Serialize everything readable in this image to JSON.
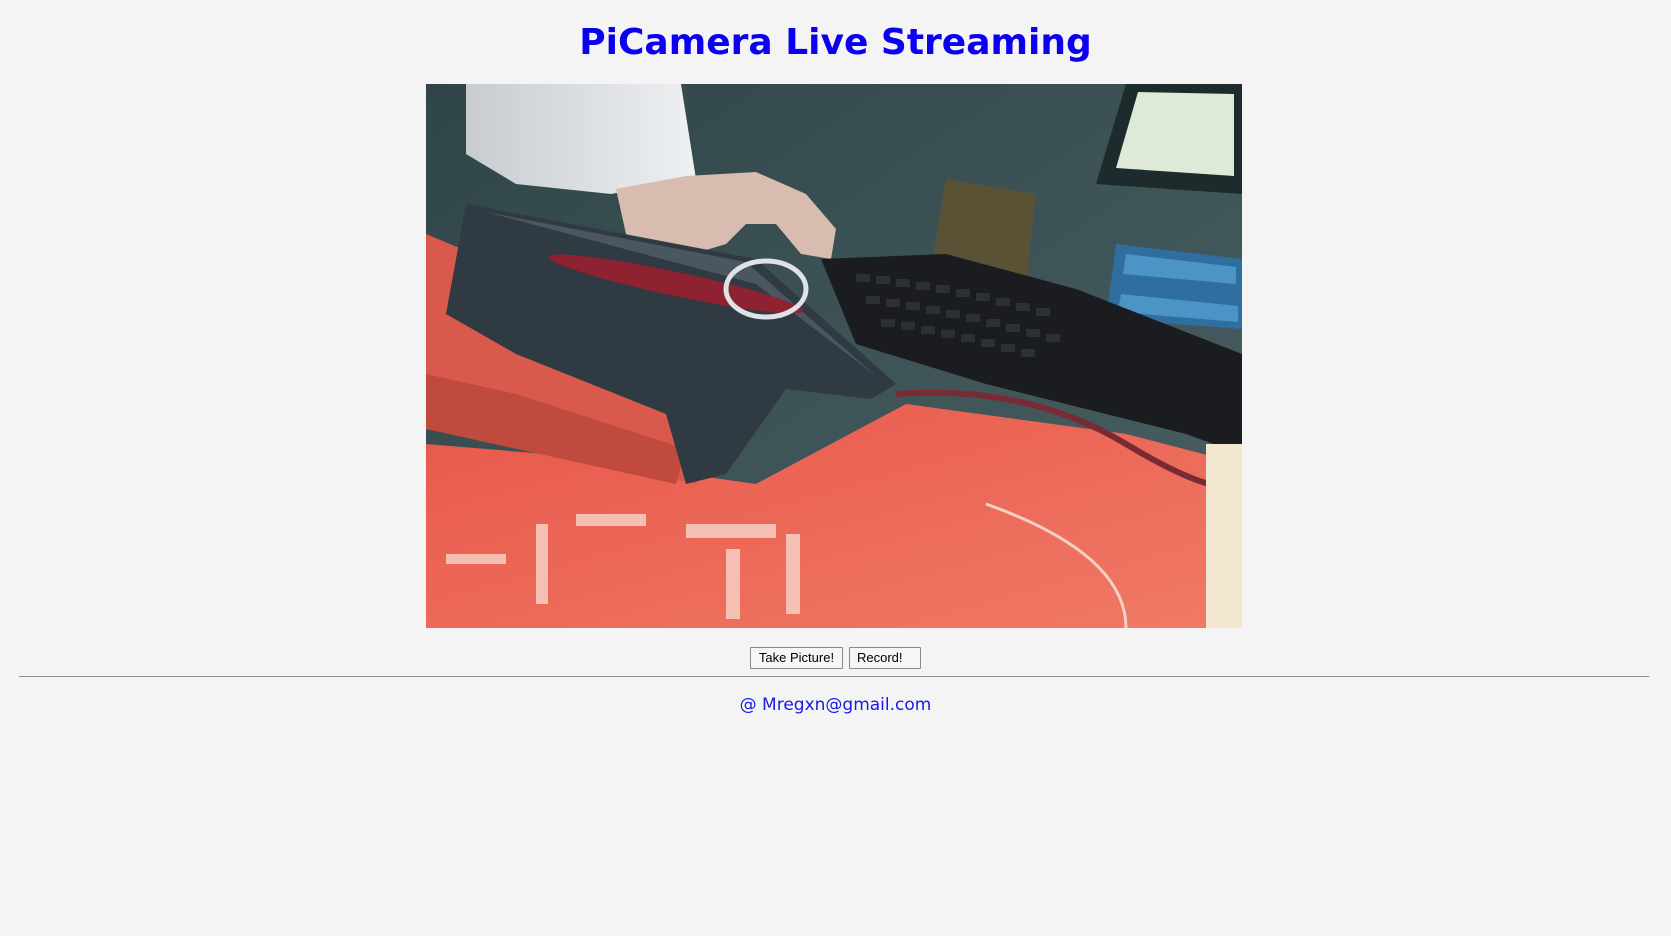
{
  "header": {
    "title": "PiCamera Live Streaming"
  },
  "stream": {
    "description_icon": "live-camera-feed"
  },
  "controls": {
    "take_picture_label": "Take Picture!",
    "record_label": "Record!"
  },
  "footer": {
    "contact": "@ Mregxn@gmail.com"
  },
  "colors": {
    "title": "#0b00f0",
    "footer_text": "#1a1ae0",
    "background": "#f4f4f4",
    "divider": "#8c8c8c"
  }
}
